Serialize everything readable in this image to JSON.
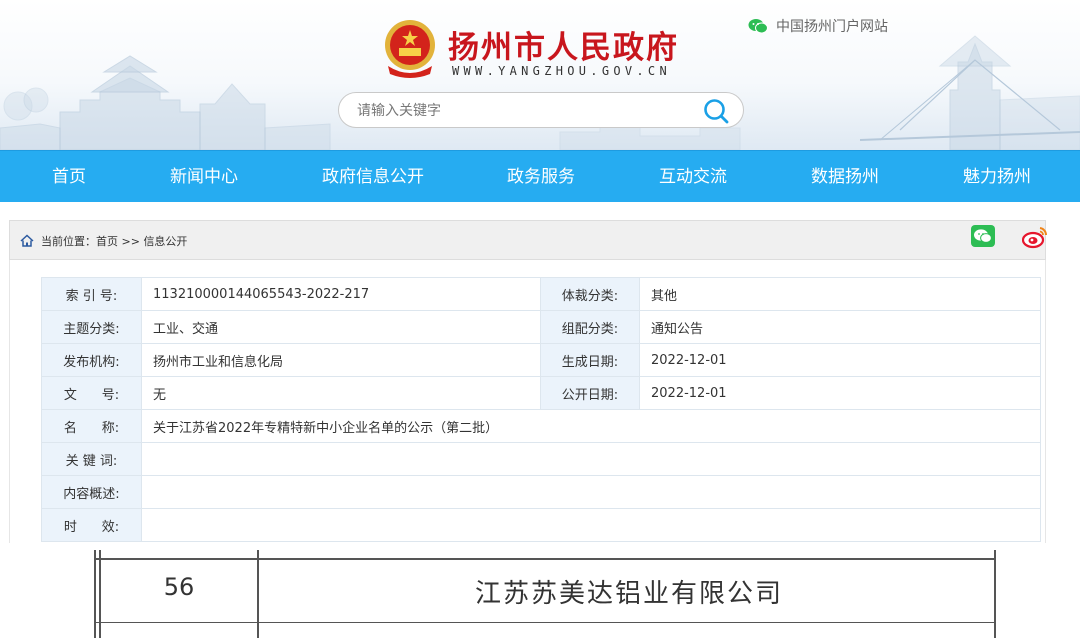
{
  "header": {
    "site_title": "扬州市人民政府",
    "site_url": "WWW.YANGZHOU.GOV.CN",
    "portal_link": "中国扬州门户网站",
    "search_placeholder": "请输入关键字",
    "colors": {
      "title": "#c8161d",
      "nav": "#26acf1"
    }
  },
  "nav": {
    "items": [
      {
        "label": "首页"
      },
      {
        "label": "新闻中心"
      },
      {
        "label": "政府信息公开"
      },
      {
        "label": "政务服务"
      },
      {
        "label": "互动交流"
      },
      {
        "label": "数据扬州"
      },
      {
        "label": "魅力扬州"
      }
    ]
  },
  "breadcrumb": {
    "prefix": "当前位置：",
    "home": "首页",
    "separator": " >> ",
    "current": "信息公开"
  },
  "share": {
    "icons": [
      "wechat-icon",
      "weibo-icon"
    ]
  },
  "meta": {
    "index_label": "索 引 号:",
    "index_value": "113210000144065543-2022-217",
    "genre_label": "体裁分类:",
    "genre_value": "其他",
    "topic_label": "主题分类:",
    "topic_value": "工业、交通",
    "category_label": "组配分类:",
    "category_value": "通知公告",
    "publisher_label": "发布机构:",
    "publisher_value": "扬州市工业和信息化局",
    "created_label": "生成日期:",
    "created_value": "2022-12-01",
    "docno_label": "文      号:",
    "docno_value": "无",
    "published_label": "公开日期:",
    "published_value": "2022-12-01",
    "name_label": "名      称:",
    "name_value": "关于江苏省2022年专精特新中小企业名单的公示（第二批）",
    "keywords_label": "关 键 词:",
    "keywords_value": "",
    "summary_label": "内容概述:",
    "summary_value": "",
    "validity_label": "时      效:",
    "validity_value": ""
  },
  "document": {
    "row_number": "56",
    "company": "江苏苏美达铝业有限公司"
  }
}
